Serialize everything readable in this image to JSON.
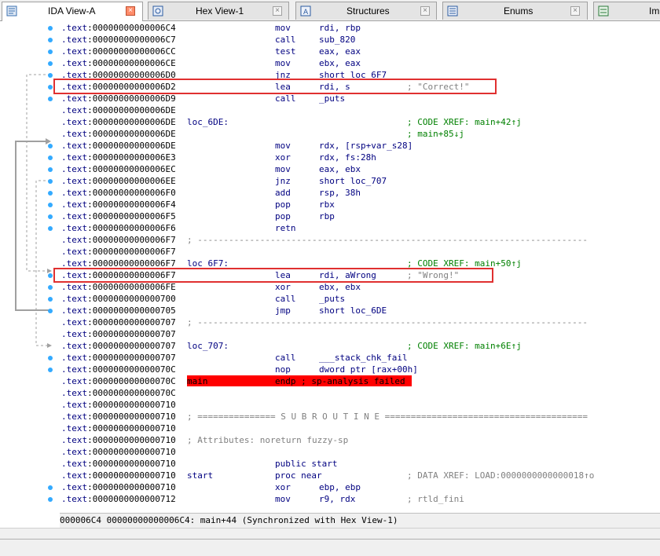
{
  "tabs": [
    {
      "label": "IDA View-A",
      "icon": "ida-view-icon"
    },
    {
      "label": "Hex View-1",
      "icon": "hex-view-icon"
    },
    {
      "label": "Structures",
      "icon": "structures-icon"
    },
    {
      "label": "Enums",
      "icon": "enums-icon"
    },
    {
      "label": "Im",
      "icon": "imports-icon"
    }
  ],
  "rows": [
    {
      "addr": "00000000000006C4",
      "mn": "mov",
      "op": "rdi, rbp"
    },
    {
      "addr": "00000000000006C7",
      "mn": "call",
      "op": "sub_820"
    },
    {
      "addr": "00000000000006CC",
      "mn": "test",
      "op": "eax, eax"
    },
    {
      "addr": "00000000000006CE",
      "mn": "mov",
      "op": "ebx, eax"
    },
    {
      "addr": "00000000000006D0",
      "mn": "jnz",
      "op": "short loc_6F7"
    },
    {
      "addr": "00000000000006D2",
      "mn": "lea",
      "op": "rdi, s",
      "cm": "; \"Correct!\""
    },
    {
      "addr": "00000000000006D9",
      "mn": "call",
      "op": "_puts"
    },
    {
      "addr": "00000000000006DE"
    },
    {
      "addr": "00000000000006DE",
      "lbl": "loc_6DE:",
      "cm": "; CODE XREF: main+42↑j",
      "xref": true
    },
    {
      "addr": "00000000000006DE",
      "cm": "; main+85↓j",
      "xref": true
    },
    {
      "addr": "00000000000006DE",
      "mn": "mov",
      "op": "rdx, [rsp+var_s28]"
    },
    {
      "addr": "00000000000006E3",
      "mn": "xor",
      "op": "rdx, fs:28h"
    },
    {
      "addr": "00000000000006EC",
      "mn": "mov",
      "op": "eax, ebx"
    },
    {
      "addr": "00000000000006EE",
      "mn": "jnz",
      "op": "short loc_707"
    },
    {
      "addr": "00000000000006F0",
      "mn": "add",
      "op": "rsp, 38h"
    },
    {
      "addr": "00000000000006F4",
      "mn": "pop",
      "op": "rbx"
    },
    {
      "addr": "00000000000006F5",
      "mn": "pop",
      "op": "rbp"
    },
    {
      "addr": "00000000000006F6",
      "mn": "retn"
    },
    {
      "addr": "00000000000006F7",
      "sep": "; ---------------------------------------------------------------------------"
    },
    {
      "addr": "00000000000006F7"
    },
    {
      "addr": "00000000000006F7",
      "lbl": "loc_6F7:",
      "cm": "; CODE XREF: main+50↑j",
      "xref": true
    },
    {
      "addr": "00000000000006F7",
      "mn": "lea",
      "op": "rdi, aWrong",
      "cm": "; \"Wrong!\""
    },
    {
      "addr": "00000000000006FE",
      "mn": "xor",
      "op": "ebx, ebx"
    },
    {
      "addr": "0000000000000700",
      "mn": "call",
      "op": "_puts"
    },
    {
      "addr": "0000000000000705",
      "mn": "jmp",
      "op": "short loc_6DE"
    },
    {
      "addr": "0000000000000707",
      "sep": "; ---------------------------------------------------------------------------"
    },
    {
      "addr": "0000000000000707"
    },
    {
      "addr": "0000000000000707",
      "lbl": "loc_707:",
      "cm": "; CODE XREF: main+6E↑j",
      "xref": true
    },
    {
      "addr": "0000000000000707",
      "mn": "call",
      "op": "___stack_chk_fail"
    },
    {
      "addr": "000000000000070C",
      "mn": "nop",
      "op": "dword ptr [rax+00h]"
    },
    {
      "addr": "000000000000070C",
      "lbl": "main",
      "mn": "endp ; sp-analysis failed",
      "error": true
    },
    {
      "addr": "000000000000070C"
    },
    {
      "addr": "0000000000000710"
    },
    {
      "addr": "0000000000000710",
      "sep": "; =============== S U B R O U T I N E ======================================="
    },
    {
      "addr": "0000000000000710"
    },
    {
      "addr": "0000000000000710",
      "sep": "; Attributes: noreturn fuzzy-sp"
    },
    {
      "addr": "0000000000000710"
    },
    {
      "addr": "0000000000000710",
      "mn": "public start"
    },
    {
      "addr": "0000000000000710",
      "lbl": "start",
      "mn": "proc near",
      "cm": "; DATA XREF: LOAD:0000000000000018↑o"
    },
    {
      "addr": "0000000000000710",
      "mn": "xor",
      "op": "ebp, ebp"
    },
    {
      "addr": "0000000000000712",
      "mn": "mov",
      "op": "r9, rdx",
      "cm": "; rtld_fini"
    }
  ],
  "segment": ".text",
  "status_line": "000006C4 00000000000006C4: main+44 (Synchronized with Hex View-1)",
  "colors": {
    "highlight_box": "#e03030",
    "error_bg": "#ff0000",
    "xref_comment": "#008000",
    "code_text": "#000080"
  }
}
